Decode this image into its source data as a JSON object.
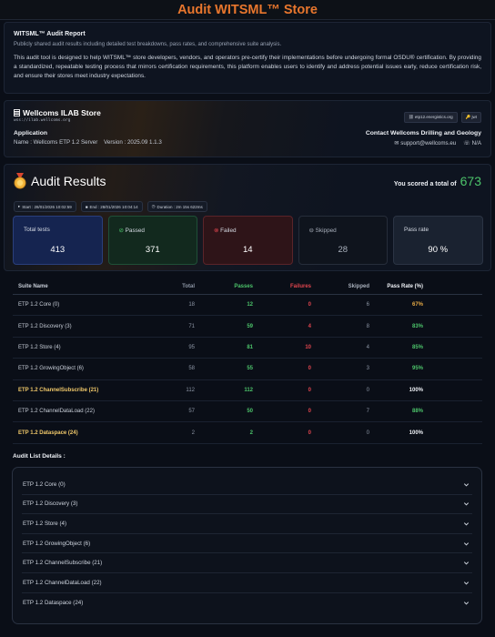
{
  "page": {
    "title": "Audit WITSML™ Store"
  },
  "intro": {
    "heading": "WITSML™ Audit Report",
    "subheading": "Publicly shared audit results including detailed test breakdowns, pass rates, and comprehensive suite analysis.",
    "body": "This audit tool is designed to help WITSML™ store developers, vendors, and operators pre-certify their implementations before undergoing formal OSDU® certification. By providing a standardized, repeatable testing process that mirrors certification requirements, this platform enables users to identify and address potential issues early, reduce certification risk, and ensure their stores meet industry expectations."
  },
  "store": {
    "name": "Wellcoms ILAB Store",
    "url": "wss://ilab.wellcoms.org",
    "app_label": "Application",
    "app_line": "Name : Wellcoms ETP 1.2 Server    Version : 2025.09 1.1.3",
    "badge_etp": "etp12.energistics.org",
    "badge_jwt": "jwt",
    "contact_title": "Contact Wellcoms Drilling and Geology",
    "contact_email": "support@wellcoms.eu",
    "contact_phone": "N/A"
  },
  "results": {
    "title": "Audit Results",
    "score_label": "You scored a total of",
    "score_value": "673",
    "start": "Start : 28/01/2026 10:02:59",
    "end": "End : 28/01/2026 10:04:14",
    "duration": "Duration : 2m 15s 622ms",
    "cards": {
      "total_label": "Total tests",
      "total_value": "413",
      "passed_label": "Passed",
      "passed_value": "371",
      "failed_label": "Failed",
      "failed_value": "14",
      "skipped_label": "Skipped",
      "skipped_value": "28",
      "rate_label": "Pass rate",
      "rate_value": "90 %"
    }
  },
  "table": {
    "headers": [
      "Suite Name",
      "Total",
      "Passes",
      "Failures",
      "Skipped",
      "Pass Rate (%)"
    ],
    "rows": [
      [
        "ETP 1.2 Core (0)",
        "18",
        "12",
        "0",
        "6",
        "67%"
      ],
      [
        "ETP 1.2 Discovery (3)",
        "71",
        "59",
        "4",
        "8",
        "83%"
      ],
      [
        "ETP 1.2 Store (4)",
        "95",
        "81",
        "10",
        "4",
        "85%"
      ],
      [
        "ETP 1.2 GrowingObject (6)",
        "58",
        "55",
        "0",
        "3",
        "95%"
      ],
      [
        "ETP 1.2 ChannelSubscribe (21)",
        "112",
        "112",
        "0",
        "0",
        "100%"
      ],
      [
        "ETP 1.2 ChannelDataLoad (22)",
        "57",
        "50",
        "0",
        "7",
        "88%"
      ],
      [
        "ETP 1.2 Dataspace (24)",
        "2",
        "2",
        "0",
        "0",
        "100%"
      ]
    ]
  },
  "audit_list": {
    "title": "Audit List Details :",
    "items": [
      "ETP 1.2 Core (0)",
      "ETP 1.2 Discovery (3)",
      "ETP 1.2 Store (4)",
      "ETP 1.2 GrowingObject (6)",
      "ETP 1.2 ChannelSubscribe (21)",
      "ETP 1.2 ChannelDataLoad (22)",
      "ETP 1.2 Dataspace (24)"
    ]
  },
  "colors": {
    "accent": "#e8762d",
    "pass": "#4cc36a",
    "fail": "#e0454e",
    "warn": "#e6a945"
  }
}
